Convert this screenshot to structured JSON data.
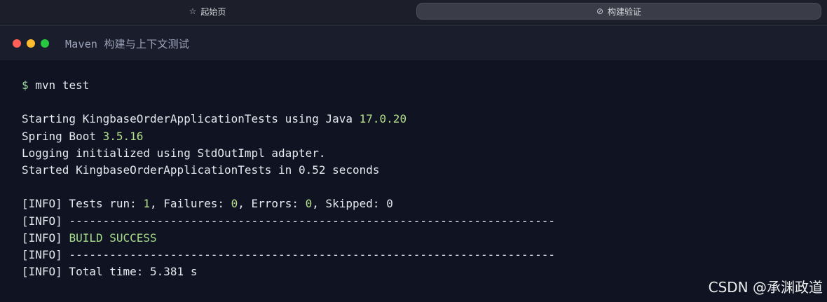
{
  "tabs": [
    {
      "icon": "star-icon",
      "label": "起始页",
      "active": false
    },
    {
      "icon": "compass-icon",
      "label": "构建验证",
      "active": true
    }
  ],
  "window": {
    "title": "Maven 构建与上下文测试",
    "traffic_lights": {
      "close": "#ff5f57",
      "minimize": "#febc2e",
      "zoom": "#28c840"
    }
  },
  "terminal": {
    "prompt": "$",
    "command": "mvn test",
    "lines": {
      "l1_text": "Starting KingbaseOrderApplicationTests using Java ",
      "l1_version": "17.0.20",
      "l2_text": "Spring Boot ",
      "l2_version": "3.5.16",
      "l3": "Logging initialized using StdOutImpl adapter.",
      "l4": "Started KingbaseOrderApplicationTests in 0.52 seconds",
      "info_tag": "[INFO]",
      "tests_run_label": " Tests run: ",
      "tests_run": "1",
      "failures_label": ", Failures: ",
      "failures": "0",
      "errors_label": ", Errors: ",
      "errors": "0",
      "skipped_label": ", Skipped: ",
      "skipped": "0",
      "separator": " ------------------------------------------------------------------------",
      "build_status": "BUILD SUCCESS",
      "total_time": " Total time: 5.381 s"
    },
    "colors": {
      "background": "#0f1322",
      "text": "#e6e8ee",
      "highlight": "#b7e08c"
    }
  },
  "watermark": "CSDN @承渊政道"
}
